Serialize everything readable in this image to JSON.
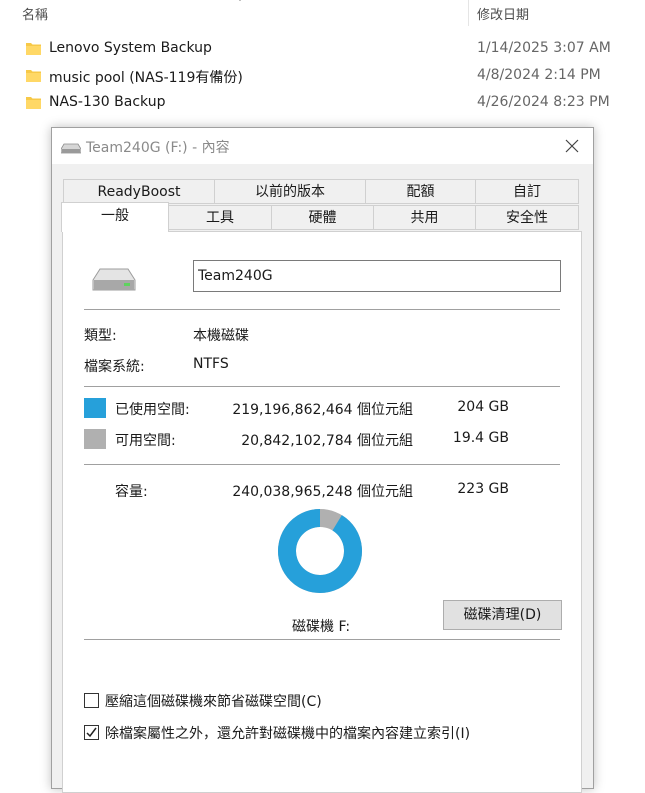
{
  "explorer": {
    "columns": {
      "name": "名稱",
      "modified": "修改日期"
    },
    "files": [
      {
        "name": "Lenovo System Backup",
        "date": "1/14/2025 3:07 AM"
      },
      {
        "name": "music pool (NAS-119有備份)",
        "date": "4/8/2024 2:14 PM"
      },
      {
        "name": "NAS-130 Backup",
        "date": "4/26/2024 8:23 PM"
      }
    ],
    "folder_color": "#f7c948"
  },
  "dialog": {
    "title": "Team240G (F:) - 內容",
    "tabs_back": [
      "ReadyBoost",
      "以前的版本",
      "配額",
      "自訂"
    ],
    "tabs_front": [
      "一般",
      "工具",
      "硬體",
      "共用",
      "安全性"
    ],
    "active_tab": "一般",
    "general": {
      "drive_name": "Team240G",
      "type_label": "類型:",
      "type_value": "本機磁碟",
      "fs_label": "檔案系統:",
      "fs_value": "NTFS",
      "used": {
        "label": "已使用空間:",
        "bytes": "219,196,862,464 個位元組",
        "size": "204 GB",
        "color": "#26a0da"
      },
      "free": {
        "label": "可用空間:",
        "bytes": "20,842,102,784 個位元組",
        "size": "19.4 GB",
        "color": "#b0b0b0"
      },
      "capacity": {
        "label": "容量:",
        "bytes": "240,038,965,248 個位元組",
        "size": "223 GB"
      },
      "used_fraction": 0.913,
      "drive_label": "磁碟機 F:",
      "cleanup_button": "磁碟清理(D)",
      "compress": {
        "label": "壓縮這個磁碟機來節省磁碟空間(C)",
        "checked": false
      },
      "index": {
        "label": "除檔案屬性之外，還允許對磁碟機中的檔案內容建立索引(I)",
        "checked": true
      }
    }
  }
}
